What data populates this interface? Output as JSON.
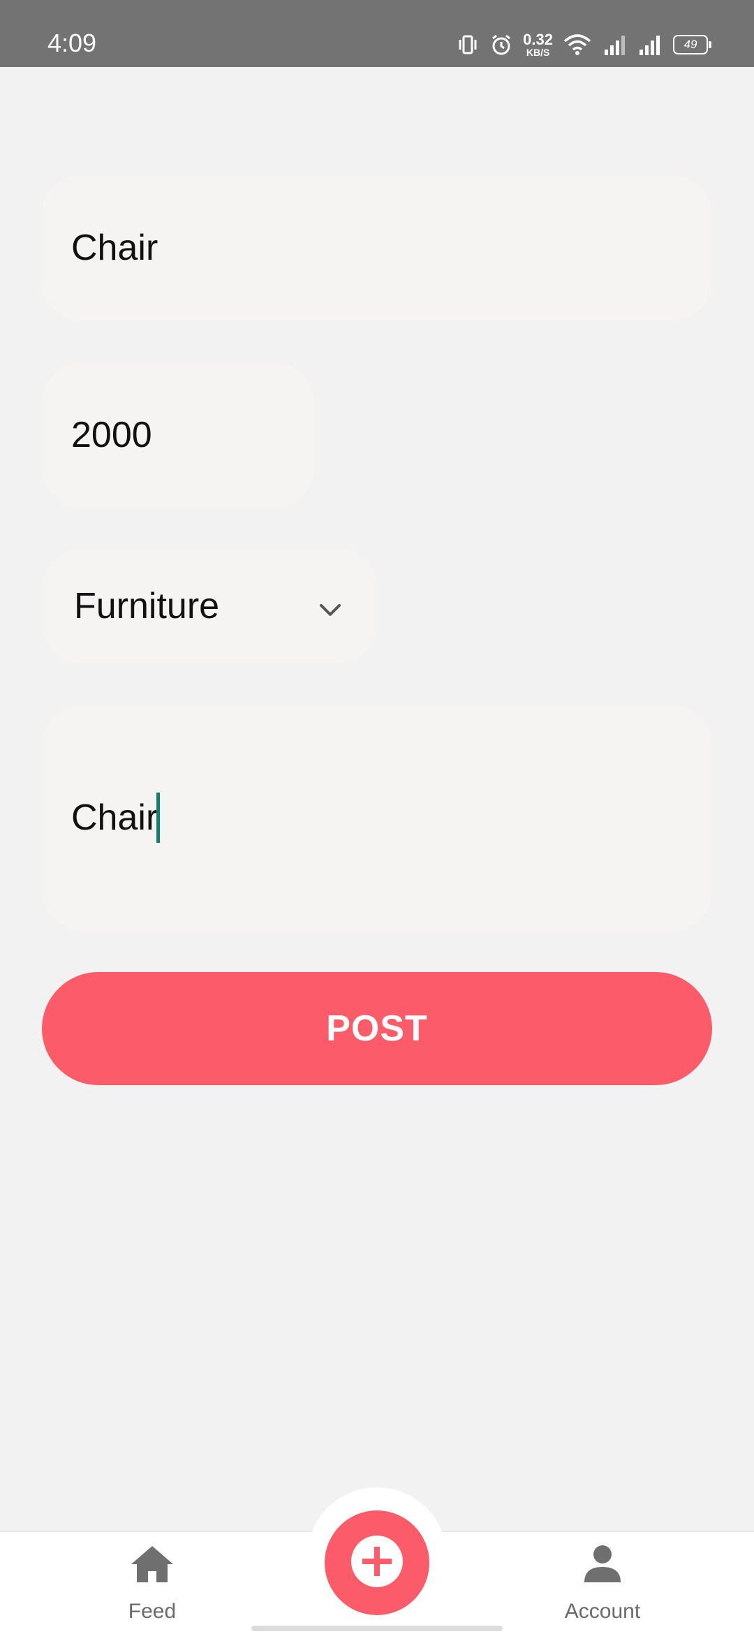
{
  "status_bar": {
    "time": "4:09",
    "net_speed_value": "0.32",
    "net_speed_unit": "KB/S",
    "battery_level": "49",
    "icons": [
      "vibrate-icon",
      "alarm-icon",
      "wifi-icon",
      "signal-icon",
      "signal-icon",
      "battery-icon"
    ]
  },
  "form": {
    "title_value": "Chair",
    "price_value": "2000",
    "category_value": "Furniture",
    "description_value": "Chair",
    "post_label": "POST"
  },
  "bottom_nav": {
    "feed_label": "Feed",
    "account_label": "Account",
    "add_icon": "plus-icon"
  },
  "colors": {
    "accent": "#fc5c6a",
    "status_bar": "#737373",
    "background": "#f2f2f2",
    "field": "#f6f4f3",
    "caret": "#11806e"
  }
}
